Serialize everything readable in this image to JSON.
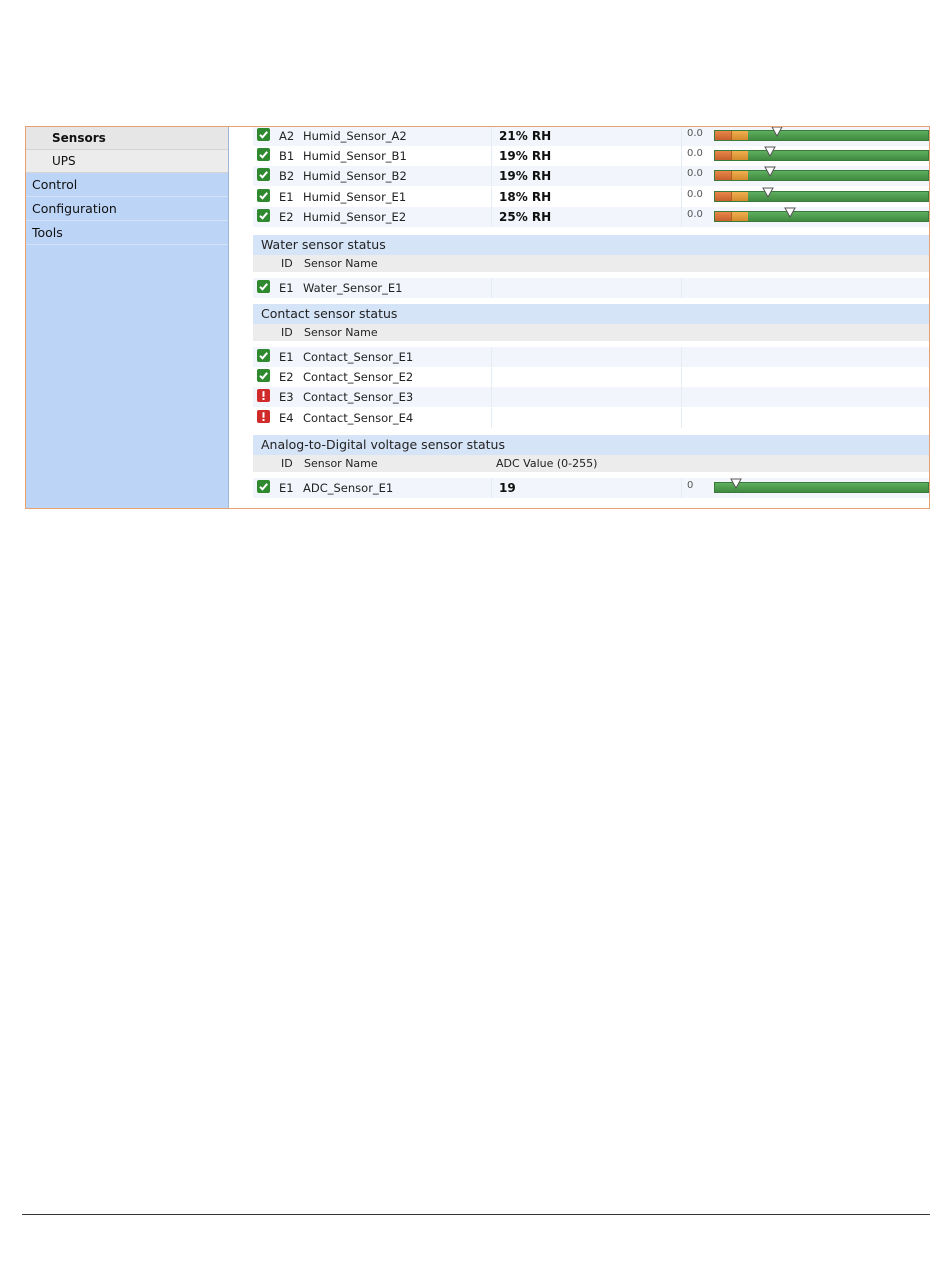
{
  "sidebar": {
    "items": [
      {
        "label": "Sensors",
        "kind": "sub",
        "active": true
      },
      {
        "label": "UPS",
        "kind": "sub",
        "active": false
      },
      {
        "label": "Control",
        "kind": "top",
        "active": false
      },
      {
        "label": "Configuration",
        "kind": "top",
        "active": false
      },
      {
        "label": "Tools",
        "kind": "top",
        "active": false
      }
    ]
  },
  "humidity_rows": [
    {
      "status": "ok",
      "id": "A2",
      "name": "Humid_Sensor_A2",
      "value": "21% RH",
      "min_label": "0.0",
      "level": 0.29
    },
    {
      "status": "ok",
      "id": "B1",
      "name": "Humid_Sensor_B1",
      "value": "19% RH",
      "min_label": "0.0",
      "level": 0.26
    },
    {
      "status": "ok",
      "id": "B2",
      "name": "Humid_Sensor_B2",
      "value": "19% RH",
      "min_label": "0.0",
      "level": 0.26
    },
    {
      "status": "ok",
      "id": "E1",
      "name": "Humid_Sensor_E1",
      "value": "18% RH",
      "min_label": "0.0",
      "level": 0.25
    },
    {
      "status": "ok",
      "id": "E2",
      "name": "Humid_Sensor_E2",
      "value": "25% RH",
      "min_label": "0.0",
      "level": 0.35
    }
  ],
  "water": {
    "title": "Water sensor status",
    "columns": {
      "id": "ID",
      "name": "Sensor Name"
    },
    "rows": [
      {
        "status": "ok",
        "id": "E1",
        "name": "Water_Sensor_E1"
      }
    ]
  },
  "contact": {
    "title": "Contact sensor status",
    "columns": {
      "id": "ID",
      "name": "Sensor Name"
    },
    "rows": [
      {
        "status": "ok",
        "id": "E1",
        "name": "Contact_Sensor_E1"
      },
      {
        "status": "ok",
        "id": "E2",
        "name": "Contact_Sensor_E2"
      },
      {
        "status": "alarm",
        "id": "E3",
        "name": "Contact_Sensor_E3"
      },
      {
        "status": "alarm",
        "id": "E4",
        "name": "Contact_Sensor_E4"
      }
    ]
  },
  "adc": {
    "title": "Analog-to-Digital voltage sensor status",
    "columns": {
      "id": "ID",
      "name": "Sensor Name",
      "value": "ADC Value (0-255)"
    },
    "rows": [
      {
        "status": "ok",
        "id": "E1",
        "name": "ADC_Sensor_E1",
        "value": "19",
        "min_label": "0",
        "level": 0.1
      }
    ]
  },
  "colors": {
    "ok": "#2f8a2f",
    "alarm": "#d12a2a",
    "section": "#d6e4f7",
    "sidebar": "#bcd4f6",
    "frame_border": "#e8a070"
  }
}
